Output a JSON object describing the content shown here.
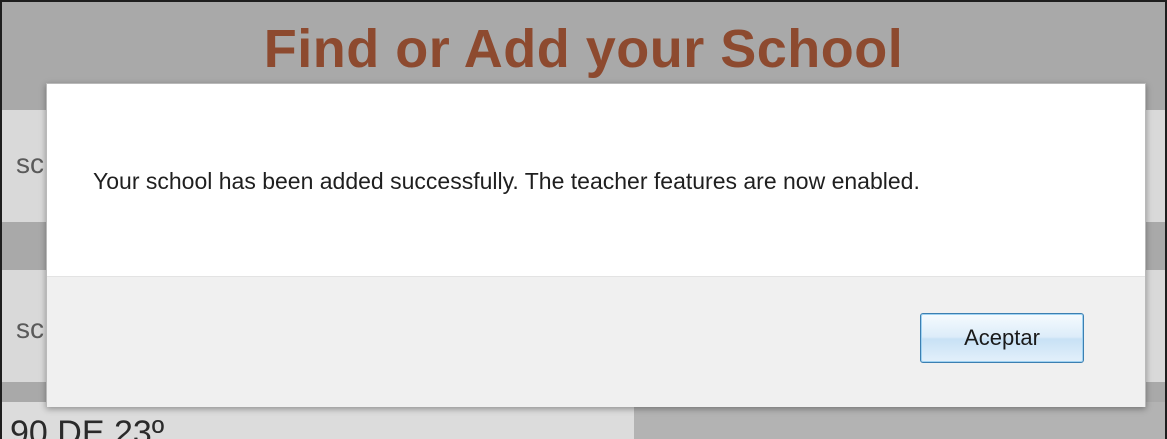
{
  "page": {
    "title": "Find or Add your School",
    "row_1_text": "sc",
    "row_2_text": "sc",
    "bottom_text": "90 DE 23º"
  },
  "dialog": {
    "message": "Your school has been added successfully. The teacher features are now enabled.",
    "ok_label": "Aceptar"
  },
  "colors": {
    "title": "#8d4a2f",
    "overlay": "#a9a9a9",
    "button_border": "#3c7fb1"
  }
}
